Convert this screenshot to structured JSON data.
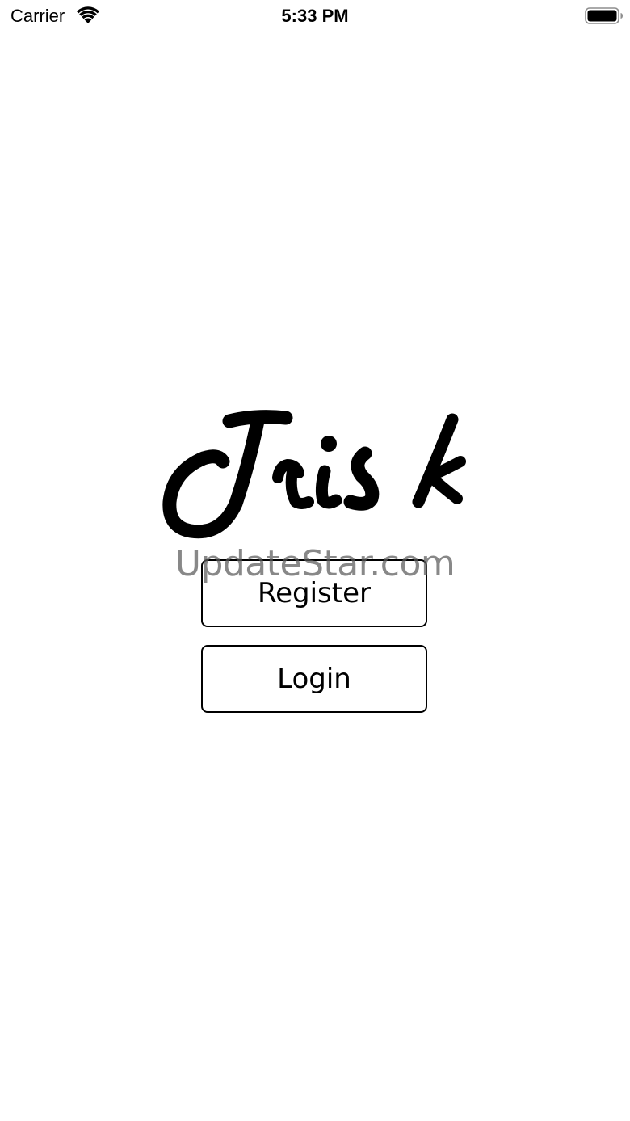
{
  "status_bar": {
    "carrier": "Carrier",
    "time": "5:33 PM",
    "wifi_icon": "wifi-icon",
    "battery_icon": "battery-full-icon"
  },
  "app": {
    "logo_text": "Trisk"
  },
  "buttons": {
    "register_label": "Register",
    "login_label": "Login"
  },
  "watermark": {
    "text": "UpdateStar.com"
  },
  "colors": {
    "background": "#ffffff",
    "foreground": "#000000",
    "watermark": "#5a5a5a"
  }
}
